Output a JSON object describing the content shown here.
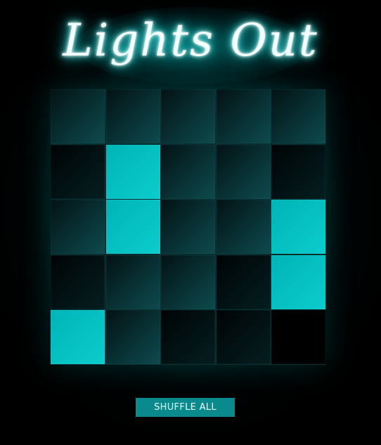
{
  "title": "Lights Out",
  "board": {
    "rows": 5,
    "cols": 5,
    "lit": [
      [
        0,
        0,
        0,
        0,
        0
      ],
      [
        0,
        1,
        0,
        0,
        0
      ],
      [
        0,
        1,
        0,
        0,
        1
      ],
      [
        0,
        0,
        0,
        0,
        1
      ],
      [
        1,
        0,
        0,
        0,
        0
      ]
    ]
  },
  "shuffle_button_label": "SHUFFLE ALL",
  "colors": {
    "light_on": "#0bbfc1",
    "light_off": "#072c2f",
    "button": "#0a8a8c",
    "glow": "#00a0a0"
  }
}
